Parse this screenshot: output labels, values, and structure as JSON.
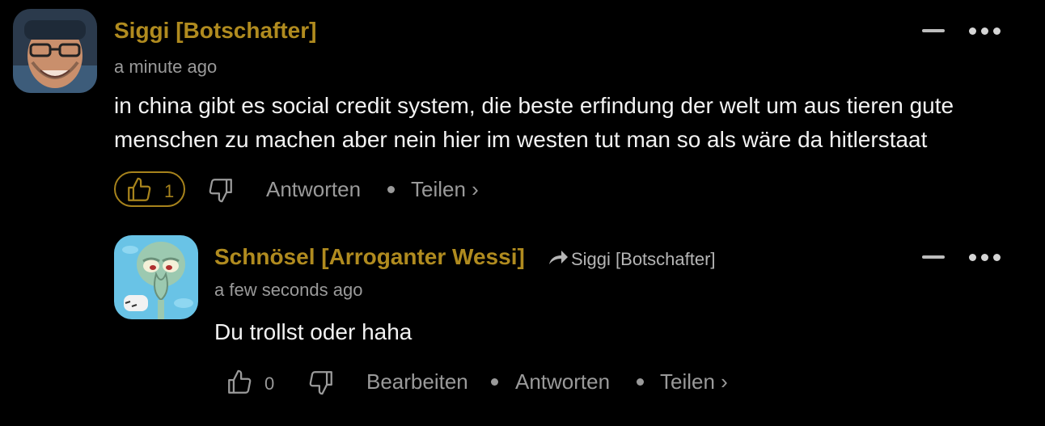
{
  "comments": [
    {
      "author": "Siggi [Botschafter]",
      "time": "a minute ago",
      "text_line1": "in china gibt es social credit system, die beste erfindung der welt um aus tieren gute",
      "text_line2": "menschen zu machen aber nein hier im westen tut man so als wäre da hitlerstaat",
      "likes": "1",
      "actions": {
        "reply": "Antworten",
        "share": "Teilen ›"
      },
      "icons": [
        "collapse-icon",
        "more-icon",
        "thumbs-up-icon",
        "thumbs-down-icon"
      ]
    },
    {
      "author": "Schnösel [Arroganter Wessi]",
      "reply_to": "Siggi [Botschafter]",
      "time": "a few seconds ago",
      "text": "Du trollst oder haha",
      "likes": "0",
      "actions": {
        "edit": "Bearbeiten",
        "reply": "Antworten",
        "share": "Teilen ›"
      },
      "icons": [
        "collapse-icon",
        "more-icon",
        "reply-arrow-icon",
        "thumbs-up-icon",
        "thumbs-down-icon"
      ]
    }
  ],
  "colors": {
    "accent": "#b08b1f",
    "muted": "#9a9a9a",
    "background": "#000000"
  }
}
